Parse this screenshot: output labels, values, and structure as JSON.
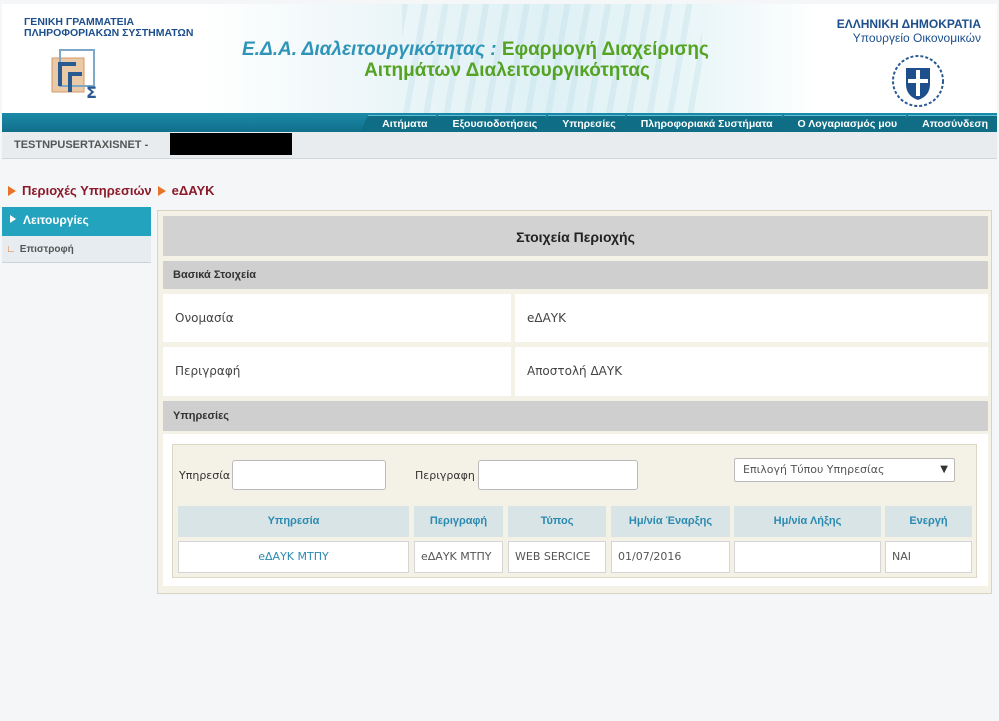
{
  "header": {
    "org_line1": "ΓΕΝΙΚΗ ΓΡΑΜΜΑΤΕΙΑ",
    "org_line2": "ΠΛΗΡΟΦΟΡΙΑΚΩΝ ΣΥΣΤΗΜΑΤΩΝ",
    "title_part1": "Ε.Δ.Α. Διαλειτουργικότητας :",
    "title_part2": "Εφαρμογή Διαχείρισης",
    "title_line2": "Αιτημάτων Διαλειτουργικότητας",
    "gov_line1": "ΕΛΛΗΝΙΚΗ ΔΗΜΟΚΡΑΤΙΑ",
    "gov_line2": "Υπουργείο Οικονομικών",
    "logo_icon": "gsis-logo-icon",
    "emblem_icon": "greek-emblem-icon"
  },
  "nav": {
    "items": [
      "Αιτήματα",
      "Εξουσιοδοτήσεις",
      "Υπηρεσίες",
      "Πληροφοριακά Συστήματα",
      "Ο Λογαριασμός μου",
      "Αποσύνδεση"
    ]
  },
  "user": {
    "username": "TESTNPUSERTAXISNET -"
  },
  "breadcrumb": {
    "item1": "Περιοχές Υπηρεσιών",
    "item2": "eΔΑΥΚ"
  },
  "sidebar": {
    "heading": "Λειτουργίες",
    "items": [
      {
        "label": "Επιστροφή"
      }
    ]
  },
  "panel": {
    "title": "Στοιχεία Περιοχής",
    "basic_heading": "Βασικά Στοιχεία",
    "name_label": "Ονομασία",
    "name_value": "eΔΑΥΚ",
    "desc_label": "Περιγραφή",
    "desc_value": "Αποστολή ΔΑΥΚ",
    "services_heading": "Υπηρεσίες"
  },
  "filters": {
    "service_label": "Υπηρεσία",
    "service_value": "",
    "description_label": "Περιγραφη",
    "description_value": "",
    "type_select": "Επιλογή Τύπου Υπηρεσίας"
  },
  "table": {
    "headers": [
      "Υπηρεσία",
      "Περιγραφή",
      "Τύπος",
      "Ημ/νία Έναρξης",
      "Ημ/νία Λήξης",
      "Ενεργή"
    ],
    "rows": [
      [
        "eΔΑΥΚ ΜΤΠΥ",
        "eΔΑΥΚ ΜΤΠΥ",
        "WEB SERCICE",
        "01/07/2016",
        "",
        "ΝΑΙ"
      ]
    ]
  },
  "colors": {
    "accent_teal": "#23a3bd",
    "nav_teal": "#116f8a",
    "breadcrumb_red": "#8b1a2b",
    "arrow_orange": "#e8742a",
    "title_green": "#55a323",
    "title_blue": "#2e95b8"
  }
}
